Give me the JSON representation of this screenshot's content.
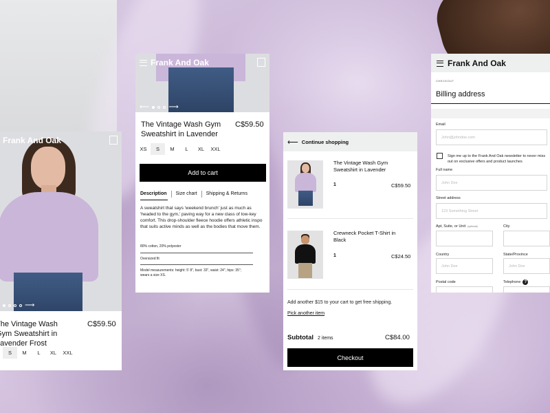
{
  "product_card": {
    "brand": "Frank And Oak",
    "title": "The Vintage Wash Gym Sweatshirt in Lavender Frost",
    "price": "C$59.50",
    "sizes": [
      "S",
      "M",
      "L",
      "XL",
      "XXL"
    ],
    "selected_size": "S"
  },
  "product_detail": {
    "brand": "Frank And Oak",
    "title": "The Vintage Wash Gym Sweatshirt in Lavender",
    "price": "C$59.50",
    "sizes": [
      "XS",
      "S",
      "M",
      "L",
      "XL",
      "XXL"
    ],
    "selected_size": "S",
    "add_to_cart": "Add to cart",
    "tabs": [
      "Description",
      "Size chart",
      "Shipping & Returns"
    ],
    "description": "A sweatshirt that says 'weekend brunch' just as much as 'headed to the gym,' paving way for a new class of low-key comfort. This drop-shoulder fleece hoodie offers athletic inspo that suits active minds as well as the bodies that move them.",
    "material": "80% cotton, 20% polyester",
    "fit": "Oversized fit",
    "measurements": "Model measurements: height: 5' 8\", bust: 33\", waist: 24\", hips: 35\"; wears a size XS."
  },
  "cart": {
    "back_label": "Continue shopping",
    "items": [
      {
        "title": "The Vintage Wash Gym Sweatshirt in Lavender",
        "qty": "1",
        "price": "C$59.50"
      },
      {
        "title": "Crewneck Pocket T-Shirt in Black",
        "qty": "1",
        "price": "C$24.50"
      }
    ],
    "shipping_note": "Add another $15 to your cart to get free shipping.",
    "pick_another": "Pick another item",
    "subtotal_label": "Subtotal",
    "subtotal_items": "2 items",
    "subtotal_value": "C$84.00",
    "checkout_label": "Checkout"
  },
  "billing": {
    "brand": "Frank And Oak",
    "step": "CHECKOUT",
    "title": "Billing address",
    "email_label": "Email",
    "email_placeholder": "John@johndoe.com",
    "newsletter_text": "Sign me up to the Frank And Oak newsletter to never miss out on exclusive offers and product launches",
    "full_name_label": "Full name",
    "full_name_placeholder": "John Doe",
    "street_label": "Street address",
    "street_placeholder": "123 Something Street",
    "apt_label": "Apt, Suite, or Unit",
    "apt_optional": "(optional)",
    "city_label": "City",
    "country_label": "Country",
    "country_placeholder": "John Doe",
    "state_label": "State/Province",
    "state_placeholder": "John Doe",
    "postal_label": "Postal code",
    "phone_label": "Telephone"
  },
  "colors": {
    "background": "#cdb9d9",
    "button": "#000000",
    "sweatshirt": "#c9b6d9"
  }
}
